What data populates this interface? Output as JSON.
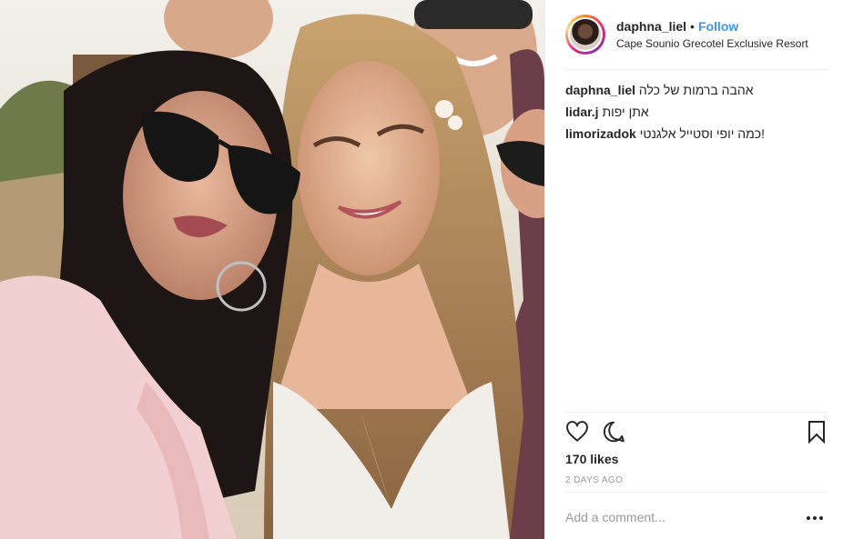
{
  "header": {
    "username": "daphna_liel",
    "separator": "•",
    "follow_label": "Follow",
    "location": "Cape Sounio Grecotel Exclusive Resort"
  },
  "comments": [
    {
      "user": "daphna_liel",
      "text": "אהבה ברמות של כלה"
    },
    {
      "user": "lidar.j",
      "text": "אתן יפות"
    },
    {
      "user": "limorizadok",
      "text": "כמה יופי וסטייל אלגנטי!"
    }
  ],
  "actions": {
    "like_icon": "heart-icon",
    "comment_icon": "comment-icon",
    "save_icon": "bookmark-icon"
  },
  "likes": "170 likes",
  "timestamp": "2 DAYS AGO",
  "add_comment": {
    "placeholder": "Add a comment..."
  },
  "more_icon": "ellipsis-icon",
  "colors": {
    "link": "#3897f0",
    "text": "#262626",
    "muted": "#999999",
    "divider": "#efefef"
  }
}
